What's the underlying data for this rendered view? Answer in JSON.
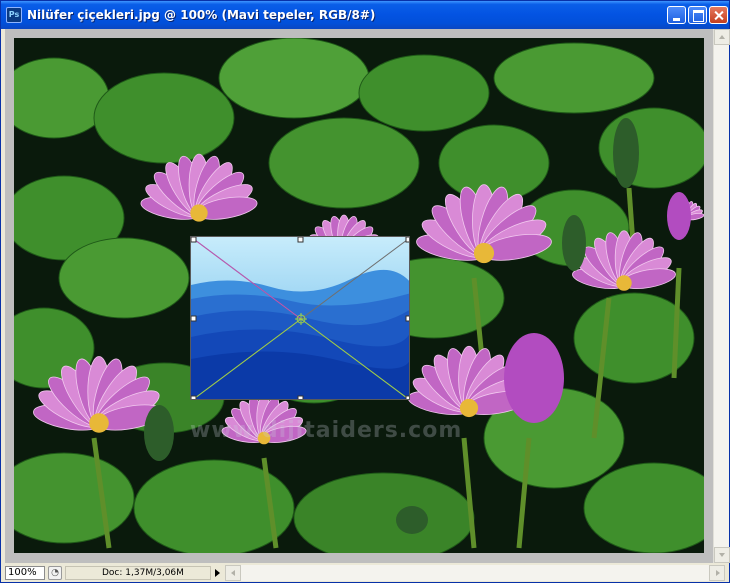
{
  "window": {
    "title": "Nilüfer çiçekleri.jpg @ 100% (Mavi tepeler, RGB/8#)",
    "app_icon": "Ps"
  },
  "canvas": {
    "watermark": "www.dijitaiders.com",
    "photo_subject": "pink water lilies with green lily pads",
    "placed_image_subject": "blue layered hills under a pale blue sky",
    "transform_box": true
  },
  "status": {
    "zoom": "100%",
    "doc_info": "Doc: 1,37M/3,06M"
  },
  "colors": {
    "titlebar": "#0353e2",
    "lily_pad": "#3e8a2a",
    "lily_petal": "#c768c9",
    "hill_dark": "#0b3fb5",
    "sky": "#8fd1f2"
  },
  "icons": {
    "app": "photoshop-icon",
    "minimize": "minimize-icon",
    "maximize": "maximize-icon",
    "close": "close-icon",
    "navigator": "navigator-icon"
  }
}
